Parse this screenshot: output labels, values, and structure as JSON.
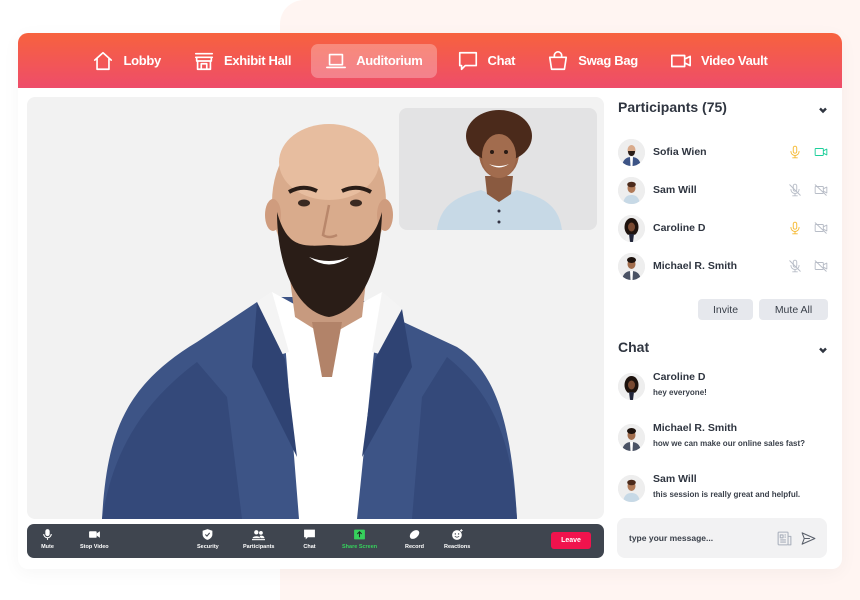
{
  "nav": {
    "items": [
      {
        "label": "Lobby",
        "icon": "home-icon"
      },
      {
        "label": "Exhibit Hall",
        "icon": "storefront-icon"
      },
      {
        "label": "Auditorium",
        "icon": "laptop-icon",
        "active": true
      },
      {
        "label": "Chat",
        "icon": "chat-bubble-icon"
      },
      {
        "label": "Swag Bag",
        "icon": "shopping-bag-icon"
      },
      {
        "label": "Video Vault",
        "icon": "video-camera-icon"
      }
    ]
  },
  "stage": {
    "main_speaker": "Bald man with beard in blue blazer",
    "pip_speaker": "Man with curly hair in light blue shirt"
  },
  "toolbar": {
    "buttons": [
      {
        "label": "Mute",
        "icon": "microphone-icon"
      },
      {
        "label": "Stop Video",
        "icon": "video-camera-icon"
      },
      {
        "label": "Security",
        "icon": "shield-icon"
      },
      {
        "label": "Participants",
        "icon": "people-icon"
      },
      {
        "label": "Chat",
        "icon": "chat-icon"
      },
      {
        "label": "Share Screen",
        "icon": "share-screen-icon"
      },
      {
        "label": "Record",
        "icon": "record-icon"
      },
      {
        "label": "Reactions",
        "icon": "emoji-icon"
      }
    ],
    "leave_label": "Leave"
  },
  "participants": {
    "title": "Participants (75)",
    "list": [
      {
        "name": "Sofia Wien",
        "mic": "on",
        "video": "on"
      },
      {
        "name": "Sam Will",
        "mic": "off",
        "video": "off"
      },
      {
        "name": "Caroline D",
        "mic": "on",
        "video": "off"
      },
      {
        "name": "Michael R. Smith",
        "mic": "off",
        "video": "off"
      }
    ],
    "invite_label": "Invite",
    "mute_all_label": "Mute All"
  },
  "chat": {
    "title": "Chat",
    "messages": [
      {
        "name": "Caroline D",
        "text": "hey everyone!"
      },
      {
        "name": "Michael R. Smith",
        "text": "how we can make our online sales fast?"
      },
      {
        "name": "Sam Will",
        "text": "this session is really great and helpful."
      }
    ],
    "input_placeholder": "type your message..."
  },
  "colors": {
    "nav_gradient_top": "#f7623e",
    "nav_gradient_bottom": "#ee4d6a",
    "mic_on": "#f5b82e",
    "video_on": "#1ccf9a",
    "muted_icon": "#b8bdc7",
    "toolbar_bg": "#3f454f",
    "share_green": "#36d15c",
    "leave_red": "#f0134d"
  }
}
